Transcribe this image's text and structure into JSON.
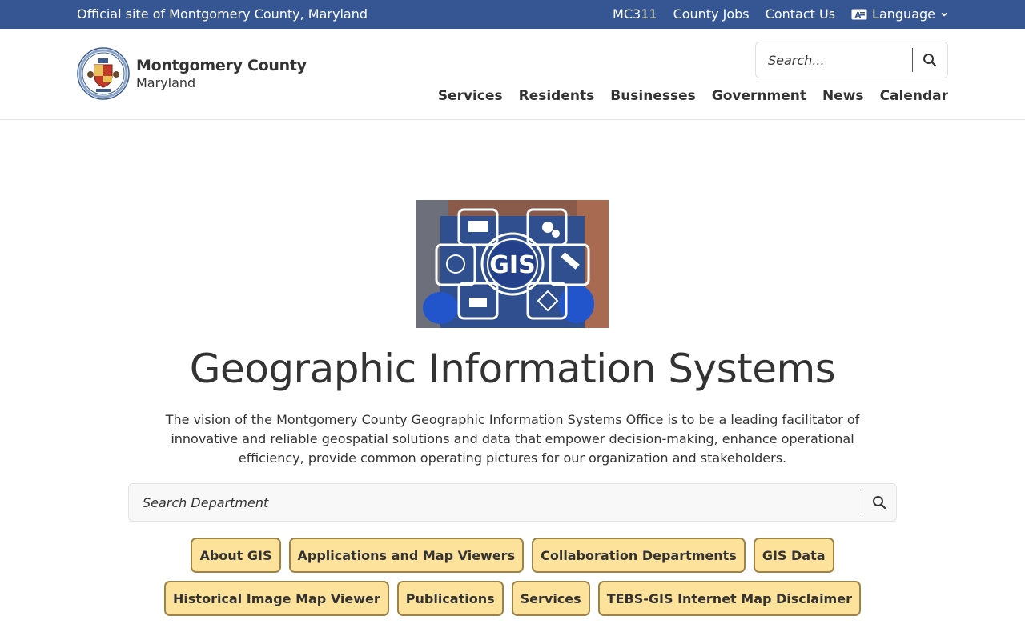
{
  "topbar": {
    "official": "Official site of Montgomery County, Maryland",
    "links": [
      "MC311",
      "County Jobs",
      "Contact Us"
    ],
    "language_label": "Language",
    "color": "#355693"
  },
  "logo": {
    "line1": "Montgomery County",
    "line2": "Maryland",
    "seal_icon": "county-seal"
  },
  "header_search": {
    "placeholder": "Search..."
  },
  "nav": [
    "Services",
    "Residents",
    "Businesses",
    "Government",
    "News",
    "Calendar"
  ],
  "hero": {
    "image_text": "GIS",
    "title": "Geographic Information Systems",
    "vision": "The vision of the Montgomery County Geographic Information Systems Office is to be a leading facilitator of innovative and reliable geospatial solutions and data that empower decision-making, enhance operational efficiency, provide common operating pictures for our organization and stakeholders."
  },
  "dept_search": {
    "placeholder": "Search Department"
  },
  "quick_links": [
    "About GIS",
    "Applications and Map Viewers",
    "Collaboration Departments",
    "GIS Data",
    "Historical Image Map Viewer",
    "Publications",
    "Services",
    "TEBS-GIS Internet Map Disclaimer"
  ],
  "colors": {
    "button_bg": "#fde29b",
    "button_border": "#9c8448"
  }
}
